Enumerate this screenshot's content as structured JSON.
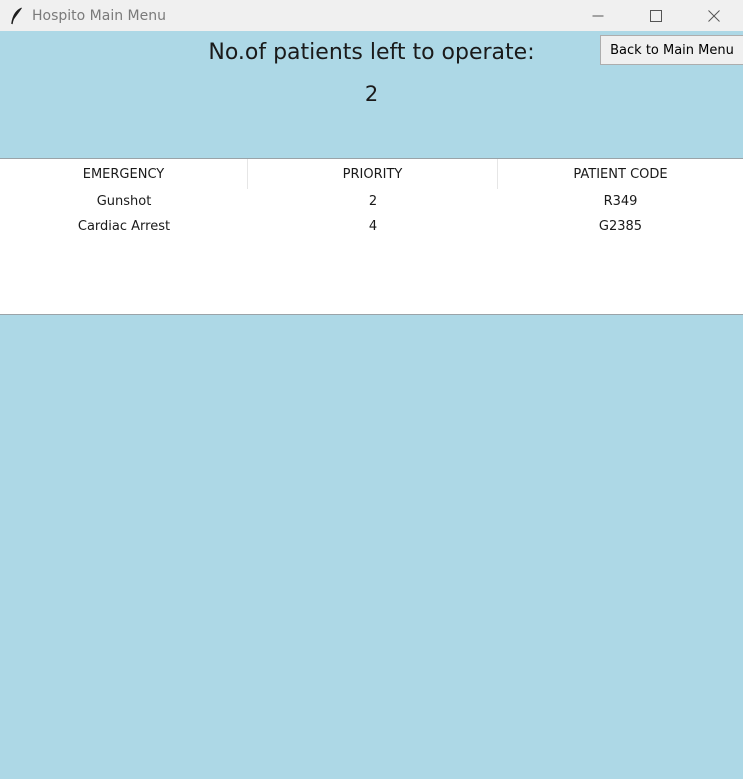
{
  "window": {
    "title": "Hospito Main Menu",
    "icon": "feather-icon"
  },
  "header": {
    "title": "No.of patients left to operate:",
    "count": "2"
  },
  "back_button": {
    "label": "Back to Main Menu"
  },
  "table": {
    "columns": [
      "EMERGENCY",
      "PRIORITY",
      "PATIENT CODE"
    ],
    "rows": [
      [
        "Gunshot",
        "2",
        "R349"
      ],
      [
        "Cardiac Arrest",
        "4",
        "G2385"
      ]
    ]
  },
  "colors": {
    "background": "#add8e6",
    "titlebar": "#f0f0f0",
    "table_background": "#ffffff"
  }
}
